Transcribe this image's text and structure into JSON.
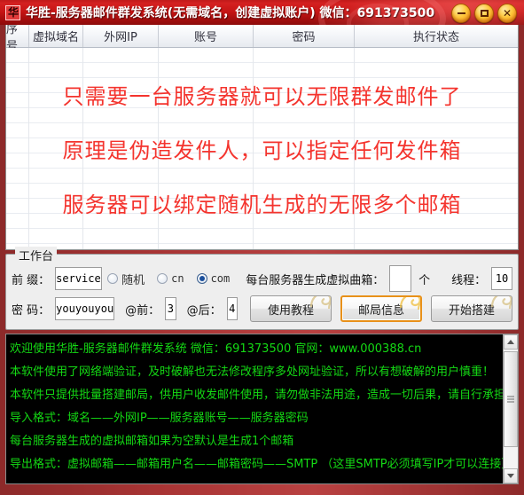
{
  "window": {
    "title": "华胜-服务器邮件群发系统(无需域名，创建虚拟账户) 微信：691373500",
    "icon": "app-icon",
    "minimize_label": "−",
    "maximize_label": "□",
    "close_label": "✕"
  },
  "grid": {
    "columns": [
      "序号",
      "虚拟域名",
      "外网IP",
      "账号",
      "密码",
      "执行状态"
    ],
    "rows": [],
    "promo_lines": [
      "只需要一台服务器就可以无限群发邮件了",
      "原理是伪造发件人，可以指定任何发件箱",
      "服务器可以绑定随机生成的无限多个邮箱"
    ],
    "promo_color": "#f4342e"
  },
  "workbench": {
    "legend": "工作台",
    "prefix_label": "前 缀：",
    "prefix_value": "service",
    "suffix_options": [
      {
        "label": "随机",
        "selected": false
      },
      {
        "label": "cn",
        "selected": false
      },
      {
        "label": "com",
        "selected": true
      }
    ],
    "mailbox_label": "每台服务器生成虚拟曲箱：",
    "mailbox_value": "",
    "mailbox_unit": "个",
    "thread_label": "线程：",
    "thread_value": "10",
    "password_label": "密 码：",
    "password_value": "youyouyou",
    "at_before_label": "@前：",
    "at_before_value": "3",
    "at_after_label": "@后：",
    "at_after_value": "4",
    "buttons": [
      {
        "label": "使用教程",
        "focused": false
      },
      {
        "label": "邮局信息",
        "focused": true
      },
      {
        "label": "开始搭建",
        "focused": false
      }
    ],
    "focus_color": "#e8911a"
  },
  "console": {
    "text_color": "#14d914",
    "lines": [
      "欢迎使用华胜-服务器邮件群发系统 微信：691373500 官网：www.000388.cn",
      "本软件使用了网络端验证，及时破解也无法修改程序多处网址验证，所以有想破解的用户慎重！",
      "本软件只提供批量搭建邮局，供用户收发邮件使用，请勿做非法用途，造成一切后果，请自行承担！",
      "导入格式：域名——外网IP——服务器账号——服务器密码",
      "每台服务器生成的虚拟邮箱如果为空默认是生成1个邮箱",
      "导出格式：虚拟邮箱——邮箱用户名——邮箱密码——SMTP （这里SMTP必须填写IP才可以连接）"
    ]
  }
}
